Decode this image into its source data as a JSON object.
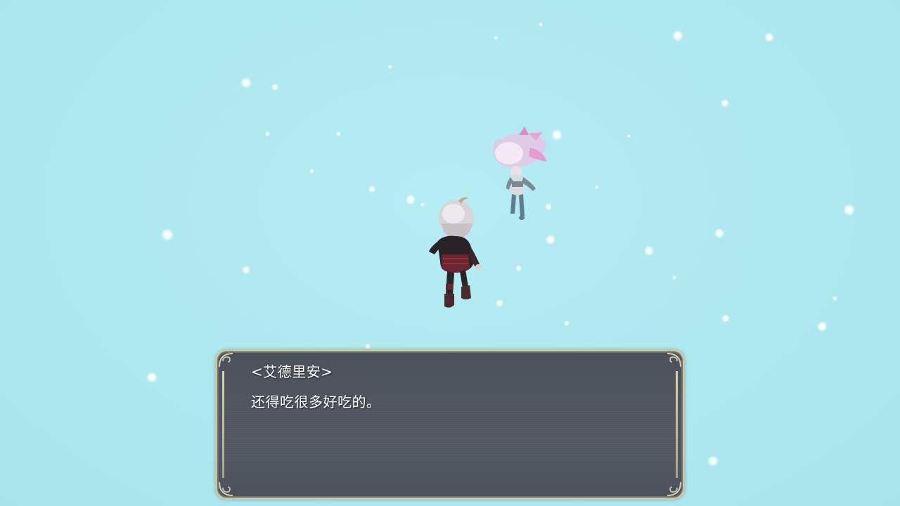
{
  "dialog": {
    "speaker": "<艾德里安>",
    "text": "还得吃很多好吃的。"
  }
}
